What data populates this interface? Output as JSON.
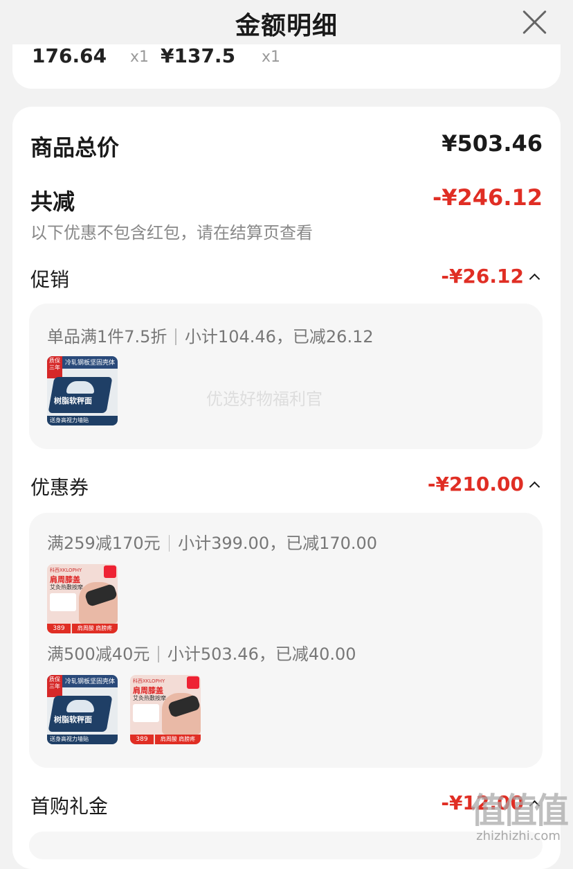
{
  "header": {
    "title": "金额明细",
    "close_icon": "close-icon"
  },
  "previous_card": {
    "price_a": "176.64",
    "qty_a": "x1",
    "price_b": "¥137.5",
    "qty_b": "x1"
  },
  "summary": {
    "total_label": "商品总价",
    "total_value": "¥503.46",
    "reduce_label": "共减",
    "reduce_value": "-¥246.12",
    "note": "以下优惠不包含红包，请在结算页查看"
  },
  "promotion": {
    "label": "促销",
    "amount": "-¥26.12",
    "rule": "单品满1件7.5折",
    "detail": "小计104.46，已减26.12",
    "center_watermark": "优选好物福利官"
  },
  "coupon": {
    "label": "优惠券",
    "amount": "-¥210.00",
    "rules": [
      {
        "rule": "满259减170元",
        "detail": "小计399.00，已减170.00"
      },
      {
        "rule": "满500减40元",
        "detail": "小计503.46，已减40.00"
      }
    ]
  },
  "first_purchase": {
    "label": "首购礼金",
    "amount": "-¥12.00"
  },
  "products": {
    "scale": {
      "badge": "质保三年",
      "band_text": "冷轧钢板坚固壳体",
      "device_text": "树脂软秤面",
      "foot_text": "送身高视力墙贴"
    },
    "massager": {
      "brand": "科西XKLOPHY",
      "title": "肩周膝盖",
      "subtitle": "艾灸热敷按摩",
      "price": "389",
      "foot_text": "肩周酸 肩膀疼"
    }
  },
  "brand_watermark": {
    "big": "值值值",
    "small": "zhizhizhi.com"
  },
  "colors": {
    "accent_red": "#e02e24",
    "background": "#f2f2f2",
    "panel": "#f6f6f6"
  }
}
